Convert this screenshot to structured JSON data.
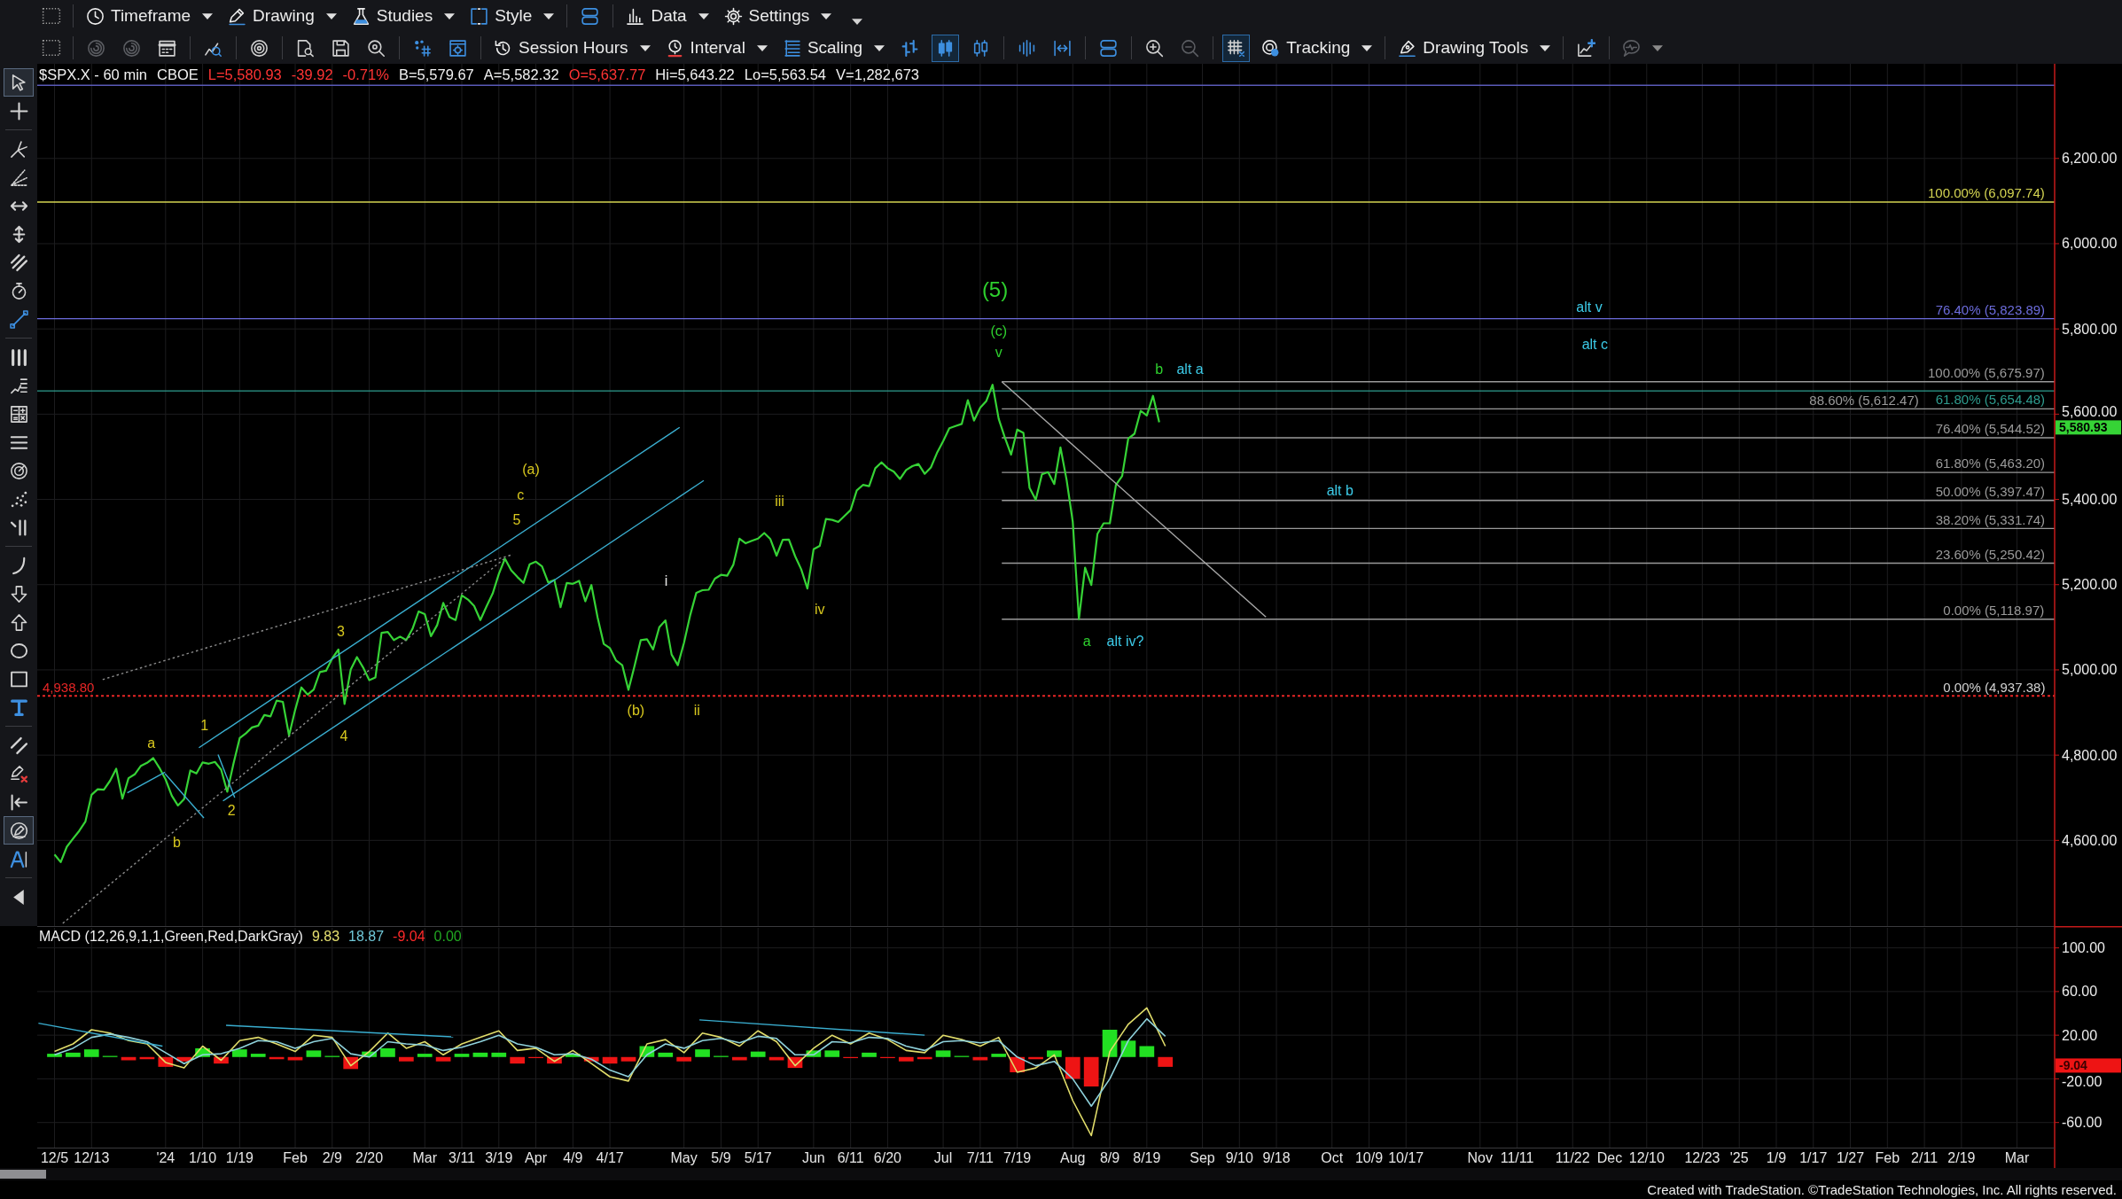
{
  "toolbar": {
    "rows": [
      [
        [
          {
            "kind": "menu",
            "label": "Timeframe",
            "selected": false,
            "disabled": false
          },
          {
            "kind": "menu",
            "label": "Drawing",
            "selected": false,
            "disabled": false
          },
          {
            "kind": "menu",
            "label": "Studies",
            "selected": false,
            "disabled": false
          },
          {
            "kind": "menu",
            "label": "Style",
            "selected": false,
            "disabled": false
          }
        ],
        [
          {
            "kind": "button",
            "selected": false,
            "disabled": false
          }
        ],
        [
          {
            "kind": "menu",
            "label": "Data",
            "selected": false,
            "disabled": false
          },
          {
            "kind": "menu",
            "label": "Settings",
            "selected": false,
            "disabled": false
          },
          {
            "kind": "button",
            "selected": false,
            "disabled": false
          }
        ]
      ],
      [
        [
          {
            "kind": "button",
            "selected": false,
            "disabled": true
          },
          {
            "kind": "button",
            "selected": false,
            "disabled": true
          },
          {
            "kind": "button",
            "selected": false,
            "disabled": false
          }
        ],
        [
          {
            "kind": "button",
            "selected": false,
            "disabled": false
          }
        ],
        [
          {
            "kind": "button",
            "selected": false,
            "disabled": false
          }
        ],
        [
          {
            "kind": "button",
            "selected": false,
            "disabled": false
          },
          {
            "kind": "button",
            "selected": false,
            "disabled": false
          },
          {
            "kind": "button",
            "selected": false,
            "disabled": false
          }
        ],
        [
          {
            "kind": "button",
            "selected": false,
            "disabled": false
          },
          {
            "kind": "button",
            "selected": false,
            "disabled": false
          }
        ],
        [
          {
            "kind": "menu",
            "label": "Session Hours",
            "selected": false,
            "disabled": false
          },
          {
            "kind": "menu",
            "label": "Interval",
            "selected": false,
            "disabled": false
          },
          {
            "kind": "menu",
            "label": "Scaling",
            "selected": false,
            "disabled": false
          },
          {
            "kind": "button",
            "selected": false,
            "disabled": false
          },
          {
            "kind": "button",
            "selected": true,
            "disabled": false
          },
          {
            "kind": "button",
            "selected": false,
            "disabled": false
          }
        ],
        [
          {
            "kind": "button",
            "selected": false,
            "disabled": false
          },
          {
            "kind": "button",
            "selected": false,
            "disabled": false
          }
        ],
        [
          {
            "kind": "button",
            "selected": false,
            "disabled": false
          }
        ],
        [
          {
            "kind": "button",
            "selected": false,
            "disabled": false
          },
          {
            "kind": "button",
            "selected": false,
            "disabled": true
          }
        ],
        [
          {
            "kind": "button",
            "selected": true,
            "disabled": false
          },
          {
            "kind": "menu",
            "label": "Tracking",
            "selected": false,
            "disabled": false
          }
        ],
        [
          {
            "kind": "menu",
            "label": "Drawing Tools",
            "selected": false,
            "disabled": false
          }
        ],
        [
          {
            "kind": "button",
            "selected": false,
            "disabled": false
          }
        ],
        [
          {
            "kind": "icon_menu",
            "selected": false,
            "disabled": true
          }
        ]
      ]
    ]
  },
  "left_toolbar": {
    "groups": [
      [
        {
          "selected": true
        },
        {
          "selected": false
        }
      ],
      [
        {
          "selected": false
        },
        {
          "selected": false
        },
        {
          "selected": false
        },
        {
          "selected": false
        },
        {
          "selected": false
        },
        {
          "selected": false
        },
        {
          "selected": false
        }
      ],
      [
        {
          "selected": false
        },
        {
          "selected": false
        },
        {
          "selected": false
        },
        {
          "selected": false
        },
        {
          "selected": false
        },
        {
          "selected": false
        },
        {
          "selected": false
        }
      ],
      [
        {
          "selected": false
        },
        {
          "selected": false
        },
        {
          "selected": false
        },
        {
          "selected": false
        },
        {
          "selected": false
        },
        {
          "selected": false
        }
      ],
      [
        {
          "selected": false
        },
        {
          "selected": false
        },
        {
          "selected": false
        },
        {
          "selected": true
        },
        {
          "selected": false
        }
      ],
      [
        {
          "selected": false
        }
      ]
    ]
  },
  "symbol_header": {
    "items": [
      {
        "text": "$SPX.X - 60 min",
        "color": "#f2f2f2"
      },
      {
        "text": "CBOE",
        "color": "#f2f2f2"
      },
      {
        "text": "L=5,580.93",
        "color": "#ff3434"
      },
      {
        "text": "-39.92",
        "color": "#ff3434"
      },
      {
        "text": "-0.71%",
        "color": "#ff3434"
      },
      {
        "text": "B=5,579.67",
        "color": "#f2f2f2"
      },
      {
        "text": "A=5,582.32",
        "color": "#f2f2f2"
      },
      {
        "text": "O=5,637.77",
        "color": "#ff3434"
      },
      {
        "text": "Hi=5,643.22",
        "color": "#f2f2f2"
      },
      {
        "text": "Lo=5,563.54",
        "color": "#f2f2f2"
      },
      {
        "text": "V=1,282,673",
        "color": "#f2f2f2"
      }
    ]
  },
  "price_panel": {
    "chart_data": {
      "type": "line",
      "grid": true,
      "categories": [
        null,
        null,
        null,
        null,
        null,
        null,
        null,
        null,
        null,
        null,
        null,
        null,
        null,
        null,
        null,
        null,
        null,
        null,
        null,
        null,
        null,
        null,
        null,
        null,
        null,
        null,
        null,
        null,
        null,
        null,
        null,
        null,
        null,
        null,
        null,
        null,
        null,
        null,
        null,
        null,
        null,
        null,
        null,
        null,
        null,
        null,
        null,
        null,
        null,
        null,
        null,
        null,
        null,
        null,
        null,
        null,
        null,
        null,
        null,
        null,
        null,
        null,
        null,
        null,
        null,
        null,
        null,
        null,
        null,
        null,
        null,
        null,
        null,
        null,
        null,
        null,
        null,
        null,
        null,
        null,
        null,
        null,
        null,
        null,
        null,
        null,
        null,
        null,
        null,
        null,
        null,
        null,
        null,
        null,
        null,
        null,
        null,
        null,
        null,
        null,
        null,
        null,
        null,
        null,
        null,
        null,
        null,
        null,
        null,
        null,
        null,
        null,
        null,
        null,
        null,
        null,
        null,
        null,
        null,
        null,
        null,
        null,
        null,
        null,
        null,
        null,
        null,
        null,
        null,
        null,
        null,
        null,
        null,
        null,
        null,
        null,
        null,
        null,
        null,
        null,
        null,
        null,
        null,
        null,
        null,
        null,
        null,
        null,
        null,
        null,
        null,
        null,
        null,
        null,
        null,
        null,
        null,
        null,
        null,
        null,
        null,
        null,
        null,
        null,
        null,
        null,
        null,
        null,
        null,
        null,
        null,
        null,
        null,
        null,
        null,
        null,
        null,
        null,
        null,
        null
      ],
      "series": [
        {
          "color": "#36d336",
          "values": [
            4567,
            4549,
            4585,
            4604,
            4622,
            4644,
            4707,
            4720,
            4719,
            4740,
            4768,
            4698,
            4746,
            4755,
            4775,
            4782,
            4793,
            4770,
            4743,
            4705,
            4682,
            4697,
            4764,
            4757,
            4783,
            4780,
            4784,
            4766,
            4714,
            4780,
            4840,
            4851,
            4865,
            4869,
            4894,
            4891,
            4928,
            4925,
            4846,
            4906,
            4959,
            4942,
            4954,
            4995,
            4998,
            5027,
            5048,
            4920,
            5001,
            5030,
            5006,
            4976,
            4982,
            5087,
            5089,
            5070,
            5078,
            5070,
            5096,
            5137,
            5131,
            5079,
            5105,
            5157,
            5124,
            5117,
            5175,
            5165,
            5150,
            5117,
            5149,
            5179,
            5225,
            5261,
            5234,
            5218,
            5204,
            5248,
            5254,
            5243,
            5205,
            5211,
            5147,
            5204,
            5202,
            5209,
            5161,
            5199,
            5123,
            5061,
            5051,
            5022,
            5011,
            4953,
            5010,
            5070,
            5072,
            5048,
            5100,
            5116,
            5036,
            5011,
            5064,
            5128,
            5181,
            5187,
            5188,
            5214,
            5223,
            5221,
            5247,
            5308,
            5297,
            5303,
            5308,
            5321,
            5307,
            5268,
            5305,
            5306,
            5267,
            5236,
            5191,
            5283,
            5291,
            5354,
            5352,
            5347,
            5361,
            5375,
            5421,
            5434,
            5431,
            5473,
            5487,
            5473,
            5465,
            5448,
            5469,
            5478,
            5483,
            5460,
            5475,
            5509,
            5537,
            5567,
            5572,
            5577,
            5633,
            5585,
            5615,
            5631,
            5669,
            5589,
            5545,
            5505,
            5564,
            5556,
            5427,
            5399,
            5459,
            5464,
            5436,
            5522,
            5446,
            5347,
            5119,
            5240,
            5199,
            5319,
            5344,
            5344,
            5434,
            5455,
            5543,
            5554,
            5608,
            5597,
            5643,
            5581
          ]
        }
      ],
      "ylim": [
        4399,
        6422
      ],
      "yticks": [
        {
          "value": 4600,
          "label": "4,600.00"
        },
        {
          "value": 4800,
          "label": "4,800.00"
        },
        {
          "value": 5000,
          "label": "5,000.00"
        },
        {
          "value": 5200,
          "label": "5,200.00"
        },
        {
          "value": 5400,
          "label": "5,400.00"
        },
        {
          "value": 5600,
          "label": "5,600.00"
        },
        {
          "value": 5800,
          "label": "5,800.00"
        },
        {
          "value": 6000,
          "label": "6,000.00"
        },
        {
          "value": 6200,
          "label": "6,200.00"
        }
      ],
      "ref_lines": [
        {
          "axis": "y",
          "value": 6371.6,
          "color": "#5a5ab8"
        },
        {
          "axis": "y",
          "value": 6097.74,
          "label": "100.00% (6,097.74)",
          "color": "#d4d452"
        },
        {
          "axis": "y",
          "value": 5823.89,
          "label": "76.40% (5,823.89)",
          "color": "#6c6cdc"
        },
        {
          "axis": "y",
          "value": 5675.97,
          "label": "100.00% (5,675.97)",
          "color": "#9a9a9a"
        },
        {
          "axis": "y",
          "value": 5654.48,
          "label": "61.80% (5,654.48)",
          "color": "#2e9c8e"
        },
        {
          "axis": "y",
          "value": 5612.47,
          "label": "88.60% (5,612.47)",
          "color": "#9a9a9a"
        },
        {
          "axis": "y",
          "value": 5544.52,
          "label": "76.40% (5,544.52)",
          "color": "#9a9a9a"
        },
        {
          "axis": "y",
          "value": 5463.2,
          "label": "61.80% (5,463.20)",
          "color": "#9a9a9a"
        },
        {
          "axis": "y",
          "value": 5397.47,
          "label": "50.00% (5,397.47)",
          "color": "#9a9a9a"
        },
        {
          "axis": "y",
          "value": 5331.74,
          "label": "38.20% (5,331.74)",
          "color": "#9a9a9a"
        },
        {
          "axis": "y",
          "value": 5250.42,
          "label": "23.60% (5,250.42)",
          "color": "#9a9a9a"
        },
        {
          "axis": "y",
          "value": 5118.97,
          "label": "0.00% (5,118.97)",
          "color": "#9a9a9a"
        },
        {
          "axis": "y",
          "value": 4938.8,
          "label": "4,938.80",
          "color": "#e82626"
        }
      ],
      "annotations": [
        "0.00% (4,937.38)"
      ]
    },
    "wave_labels": [
      {
        "text": "a",
        "color": "#d8c81e"
      },
      {
        "text": "b",
        "color": "#d8c81e"
      },
      {
        "text": "1",
        "color": "#d8c81e"
      },
      {
        "text": "2",
        "color": "#d8c81e"
      },
      {
        "text": "3",
        "color": "#d8c81e"
      },
      {
        "text": "4",
        "color": "#d8c81e"
      },
      {
        "text": "(a)",
        "color": "#d8c81e"
      },
      {
        "text": "c",
        "color": "#d8c81e"
      },
      {
        "text": "5",
        "color": "#d8c81e"
      },
      {
        "text": "(b)",
        "color": "#d8c81e"
      },
      {
        "text": "i",
        "color": "#e6e6e6"
      },
      {
        "text": "ii",
        "color": "#d8c81e"
      },
      {
        "text": "iii",
        "color": "#d8c81e"
      },
      {
        "text": "iv",
        "color": "#d8c81e"
      },
      {
        "text": "(5)",
        "color": "#2ed12e"
      },
      {
        "text": "(c)",
        "color": "#2ed12e"
      },
      {
        "text": "v",
        "color": "#2ed12e"
      },
      {
        "text": "a",
        "color": "#2ed12e"
      },
      {
        "text": "alt iv?",
        "color": "#3ccbe8"
      },
      {
        "text": "b",
        "color": "#2ed12e"
      },
      {
        "text": "alt a",
        "color": "#3ccbe8"
      },
      {
        "text": "alt b",
        "color": "#3ccbe8"
      },
      {
        "text": "alt v",
        "color": "#3ccbe8"
      },
      {
        "text": "alt c",
        "color": "#3ccbe8"
      }
    ],
    "last_value": {
      "text": "5,580.93"
    }
  },
  "macd_panel": {
    "title": "MACD (12,26,9,1,1,Green,Red,DarkGray)",
    "readings": [
      {
        "text": "9.83",
        "color": "#e6e070"
      },
      {
        "text": "18.87",
        "color": "#6fc6d6"
      },
      {
        "text": "-9.04",
        "color": "#ff2a2a"
      },
      {
        "text": "0.00",
        "color": "#22a822"
      }
    ],
    "chart_data": {
      "type": "line",
      "grid": true,
      "categories": [
        "12/5",
        null,
        "12/13",
        null,
        null,
        null,
        "'24",
        null,
        "1/10",
        null,
        "1/19",
        null,
        null,
        "Feb",
        null,
        "2/9",
        null,
        "2/20",
        null,
        null,
        "Mar",
        null,
        "3/11",
        null,
        "3/19",
        null,
        "Apr",
        null,
        "4/9",
        null,
        "4/17",
        null,
        null,
        null,
        "May",
        null,
        "5/9",
        null,
        "5/17",
        null,
        null,
        "Jun",
        null,
        "6/11",
        null,
        "6/20",
        null,
        null,
        "Jul",
        null,
        "7/11",
        null,
        "7/19",
        null,
        null,
        "Aug",
        null,
        "8/9",
        null,
        "8/19",
        null,
        null,
        "Sep",
        null,
        "9/10",
        null,
        "9/18",
        null,
        null,
        "Oct",
        null,
        "10/9",
        null,
        "10/17",
        null,
        null,
        null,
        "Nov",
        null,
        "11/11",
        null,
        null,
        "11/22",
        null,
        "Dec",
        null,
        "12/10",
        null,
        null,
        "12/23",
        null,
        "'25",
        null,
        "1/9",
        null,
        "1/17",
        null,
        "1/27",
        null,
        "Feb",
        null,
        "2/11",
        null,
        "2/19",
        null,
        null,
        "Mar",
        null
      ],
      "series": [
        {
          "color": "#e0dc6a",
          "values": [
            5,
            12,
            25,
            22,
            15,
            12,
            -5,
            -10,
            10,
            -3,
            15,
            18,
            12,
            5,
            20,
            18,
            -8,
            5,
            22,
            8,
            14,
            2,
            12,
            18,
            24,
            6,
            8,
            -4,
            6,
            -6,
            -18,
            -22,
            12,
            16,
            4,
            22,
            18,
            10,
            24,
            14,
            -8,
            8,
            20,
            12,
            22,
            16,
            6,
            4,
            20,
            16,
            10,
            18,
            -14,
            -10,
            2,
            -40,
            -72,
            5,
            30,
            45,
            10,
            null,
            null,
            null,
            null,
            null,
            null,
            null,
            null,
            null,
            null,
            null,
            null,
            null,
            null,
            null,
            null,
            null,
            null,
            null,
            null,
            null,
            null,
            null,
            null,
            null,
            null,
            null,
            null,
            null,
            null,
            null,
            null,
            null,
            null,
            null,
            null,
            null,
            null,
            null,
            null,
            null,
            null,
            null,
            null,
            null,
            null,
            null
          ]
        },
        {
          "color": "#8fd2dc",
          "values": [
            2,
            8,
            18,
            21,
            18,
            14,
            4,
            -6,
            2,
            3,
            8,
            15,
            14,
            8,
            14,
            17,
            3,
            0,
            14,
            12,
            11,
            6,
            9,
            14,
            20,
            12,
            9,
            2,
            3,
            -2,
            -12,
            -18,
            2,
            12,
            8,
            15,
            17,
            13,
            19,
            17,
            2,
            2,
            14,
            13,
            18,
            17,
            10,
            6,
            14,
            15,
            13,
            15,
            0,
            -8,
            -4,
            -20,
            -45,
            -20,
            15,
            35,
            19,
            null,
            null,
            null,
            null,
            null,
            null,
            null,
            null,
            null,
            null,
            null,
            null,
            null,
            null,
            null,
            null,
            null,
            null,
            null,
            null,
            null,
            null,
            null,
            null,
            null,
            null,
            null,
            null,
            null,
            null,
            null,
            null,
            null,
            null,
            null,
            null,
            null,
            null,
            null,
            null,
            null,
            null,
            null,
            null,
            null,
            null,
            null
          ]
        },
        {
          "type": "bar",
          "color": "#22e022",
          "values": [
            3,
            4,
            7,
            1,
            null,
            null,
            null,
            null,
            8,
            null,
            7,
            3,
            null,
            null,
            6,
            1,
            null,
            5,
            8,
            null,
            3,
            null,
            3,
            4,
            4,
            null,
            null,
            null,
            3,
            null,
            null,
            null,
            10,
            4,
            null,
            7,
            1,
            null,
            5,
            null,
            null,
            6,
            6,
            null,
            4,
            null,
            null,
            null,
            6,
            1,
            null,
            3,
            null,
            null,
            6,
            null,
            null,
            25,
            15,
            10,
            null,
            null,
            null,
            null,
            null,
            null,
            null,
            null,
            null,
            null,
            null,
            null,
            null,
            null,
            null,
            null,
            null,
            null,
            null,
            null,
            null,
            null,
            null,
            null,
            null,
            null,
            null,
            null,
            null,
            null,
            null,
            null,
            null,
            null,
            null,
            null,
            null,
            null,
            null,
            null,
            null,
            null,
            null,
            null,
            null,
            null,
            null,
            null
          ]
        },
        {
          "type": "bar",
          "color": "#ee1414",
          "values": [
            null,
            null,
            null,
            null,
            -3,
            -2,
            -9,
            -4,
            null,
            -6,
            null,
            null,
            -2,
            -3,
            null,
            null,
            -11,
            null,
            null,
            -4,
            null,
            -4,
            null,
            null,
            null,
            -6,
            -1,
            -6,
            null,
            -4,
            -6,
            -4,
            null,
            null,
            -4,
            null,
            null,
            -3,
            null,
            -3,
            -10,
            null,
            null,
            -1,
            null,
            -1,
            -4,
            -2,
            null,
            null,
            -3,
            null,
            -14,
            -2,
            null,
            -20,
            -27,
            null,
            null,
            null,
            -9,
            null,
            null,
            null,
            null,
            null,
            null,
            null,
            null,
            null,
            null,
            null,
            null,
            null,
            null,
            null,
            null,
            null,
            null,
            null,
            null,
            null,
            null,
            null,
            null,
            null,
            null,
            null,
            null,
            null,
            null,
            null,
            null,
            null,
            null,
            null,
            null,
            null,
            null,
            null,
            null,
            null,
            null,
            null,
            null,
            null,
            null,
            null
          ]
        }
      ],
      "ylim": [
        -83,
        120
      ],
      "yticks": [
        {
          "value": 100,
          "label": "100.00"
        },
        {
          "value": 60,
          "label": "60.00"
        },
        {
          "value": 20,
          "label": "20.00"
        },
        {
          "value": -20,
          "label": "-20.00"
        },
        {
          "value": -60,
          "label": "-60.00"
        }
      ]
    },
    "last_value": {
      "text": "-9.04"
    }
  },
  "footer": {
    "text": "Created with TradeStation. ©TradeStation Technologies, Inc. All rights reserved."
  }
}
